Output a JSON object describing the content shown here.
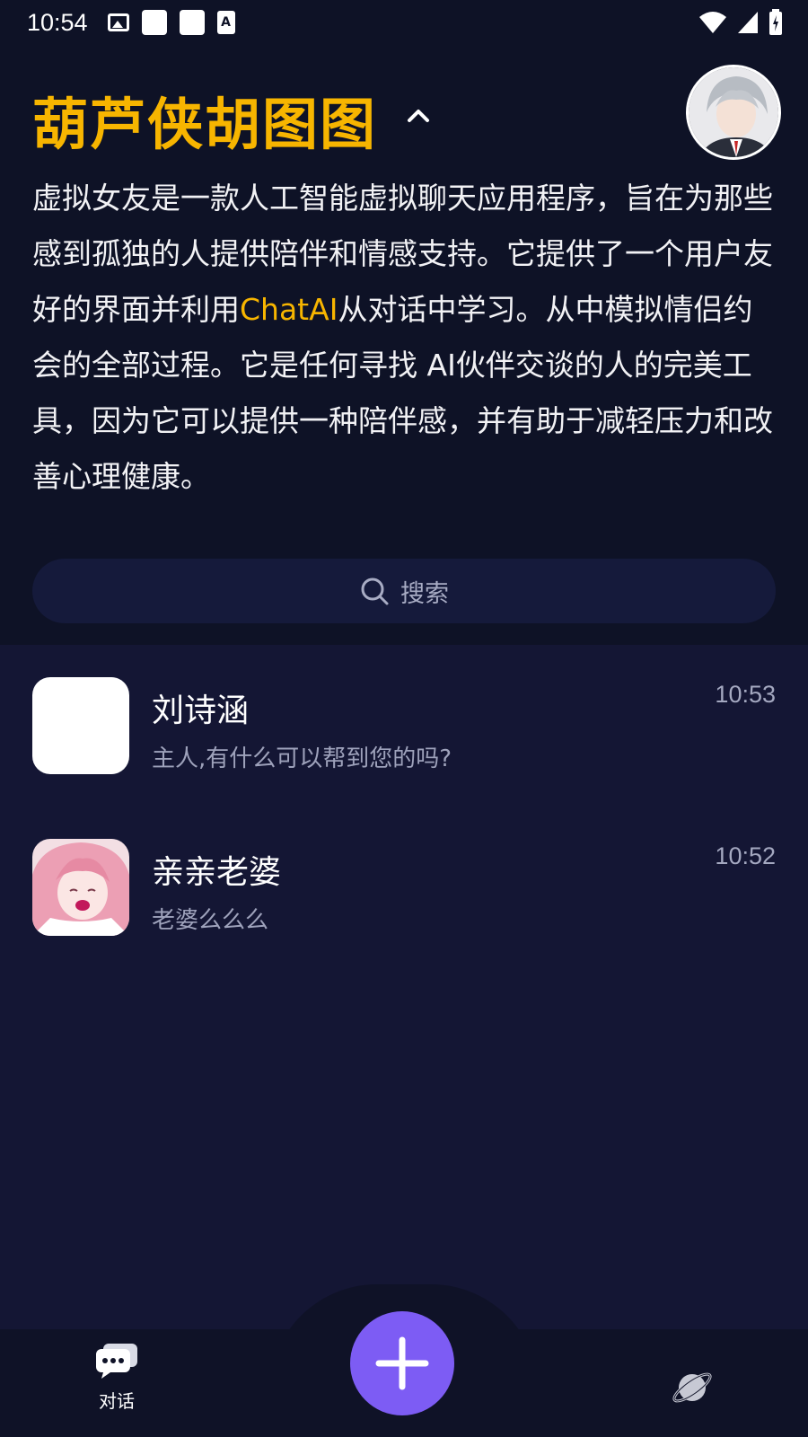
{
  "status_bar": {
    "time": "10:54",
    "a_icon_text": "A"
  },
  "header": {
    "title": "葫芦侠胡图图"
  },
  "description": {
    "before": "虚拟女友是一款人工智能虚拟聊天应用程序，旨在为那些感到孤独的人提供陪伴和情感支持。它提供了一个用户友好的界面并利用",
    "highlight": "ChatAI",
    "after": "从对话中学习。从中模拟情侣约会的全部过程。它是任何寻找 AI伙伴交谈的人的完美工具，因为它可以提供一种陪伴感，并有助于减轻压力和改善心理健康。"
  },
  "search": {
    "placeholder": "搜索"
  },
  "chats": [
    {
      "name": "刘诗涵",
      "message": "主人,有什么可以帮到您的吗?",
      "time": "10:53"
    },
    {
      "name": "亲亲老婆",
      "message": "老婆么么么",
      "time": "10:52"
    }
  ],
  "nav": {
    "chat_label": "对话"
  },
  "colors": {
    "accent": "#f7b500",
    "fab": "#7d5cf4",
    "background": "#0e1226",
    "panel": "#141634"
  }
}
